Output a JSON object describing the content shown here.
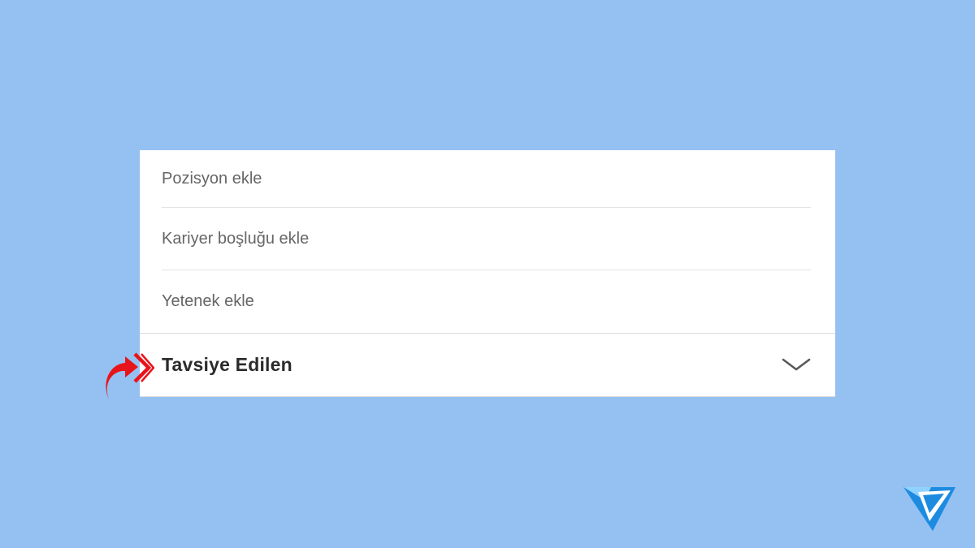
{
  "menu": {
    "items": [
      {
        "label": "Pozisyon ekle"
      },
      {
        "label": "Kariyer boşluğu ekle"
      },
      {
        "label": "Yetenek ekle"
      }
    ],
    "section": {
      "title": "Tavsiye Edilen",
      "icon": "chevron-down-icon"
    }
  },
  "annotations": {
    "pointer_icon": "red-arrow-icon",
    "pointer_color": "#e8141b"
  },
  "branding": {
    "logo_icon": "brand-logo-icon",
    "logo_color": "#1d8be0"
  },
  "colors": {
    "background": "#94c1f2",
    "panel": "#ffffff",
    "item_text": "#666666",
    "section_text": "#2b2b2b"
  }
}
